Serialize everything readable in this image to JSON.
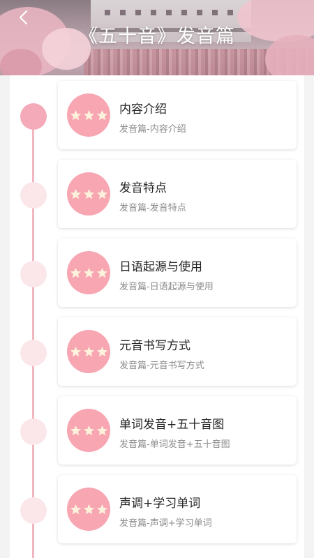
{
  "header": {
    "title": "《五十音》发音篇",
    "back_icon": "chevron-left-icon"
  },
  "colors": {
    "accent_pink": "#f7a6b2",
    "timeline_pink": "#f2b6c1",
    "dot_active": "#f4aab9",
    "dot_inactive": "#fbe6ea",
    "star_fill": "#fdf3dc"
  },
  "lessons": [
    {
      "title": "内容介绍",
      "subtitle": "发音篇-内容介绍",
      "active": true
    },
    {
      "title": "发音特点",
      "subtitle": "发音篇-发音特点",
      "active": false
    },
    {
      "title": "日语起源与使用",
      "subtitle": "发音篇-日语起源与使用",
      "active": false
    },
    {
      "title": "元音书写方式",
      "subtitle": "发音篇-元音书写方式",
      "active": false
    },
    {
      "title": "单词发音+五十音图",
      "subtitle": "发音篇-单词发音+五十音图",
      "active": false
    },
    {
      "title": "声调+学习单词",
      "subtitle": "发音篇-声调+学习单词",
      "active": false
    }
  ]
}
